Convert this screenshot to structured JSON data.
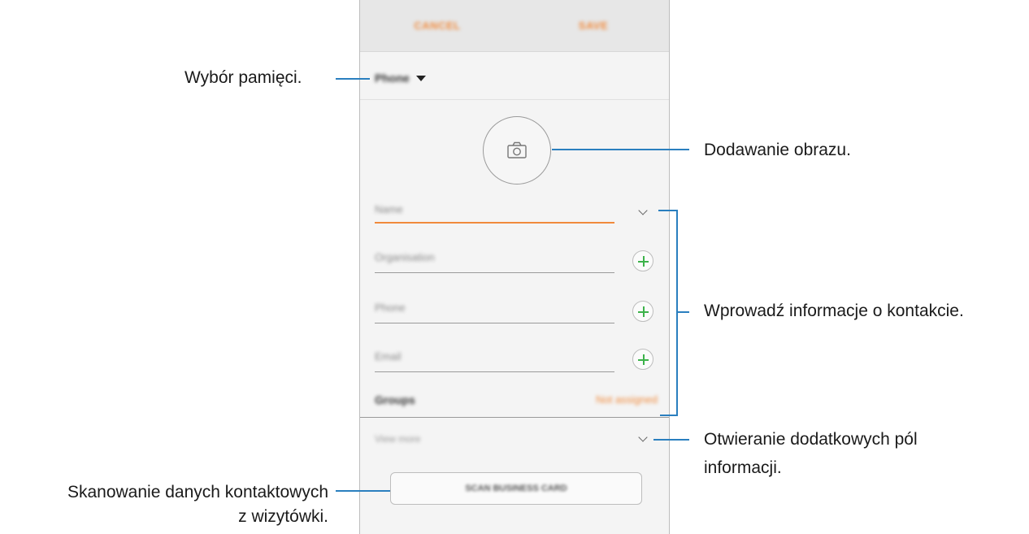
{
  "screen": {
    "topbar": {
      "cancel_label": "CANCEL",
      "save_label": "SAVE"
    },
    "storage": {
      "label": "Phone"
    },
    "fields": {
      "name_placeholder": "Name",
      "organisation_placeholder": "Organisation",
      "phone_placeholder": "Phone",
      "email_placeholder": "Email"
    },
    "groups": {
      "label": "Groups",
      "value": "Not assigned"
    },
    "view_more_label": "View more",
    "scan_button_label": "SCAN BUSINESS CARD",
    "accent_color": "#f08a3c",
    "add_icon_color": "#3cb24a"
  },
  "callouts": {
    "storage": "Wybór pamięci.",
    "photo": "Dodawanie obrazu.",
    "contact_info": "Wprowadź informacje o kontakcie.",
    "more_fields_line1": "Otwieranie dodatkowych pól",
    "more_fields_line2": "informacji.",
    "scan_line1": "Skanowanie danych kontaktowych",
    "scan_line2": "z wizytówki."
  },
  "callout_line_color": "#2a7fbf"
}
